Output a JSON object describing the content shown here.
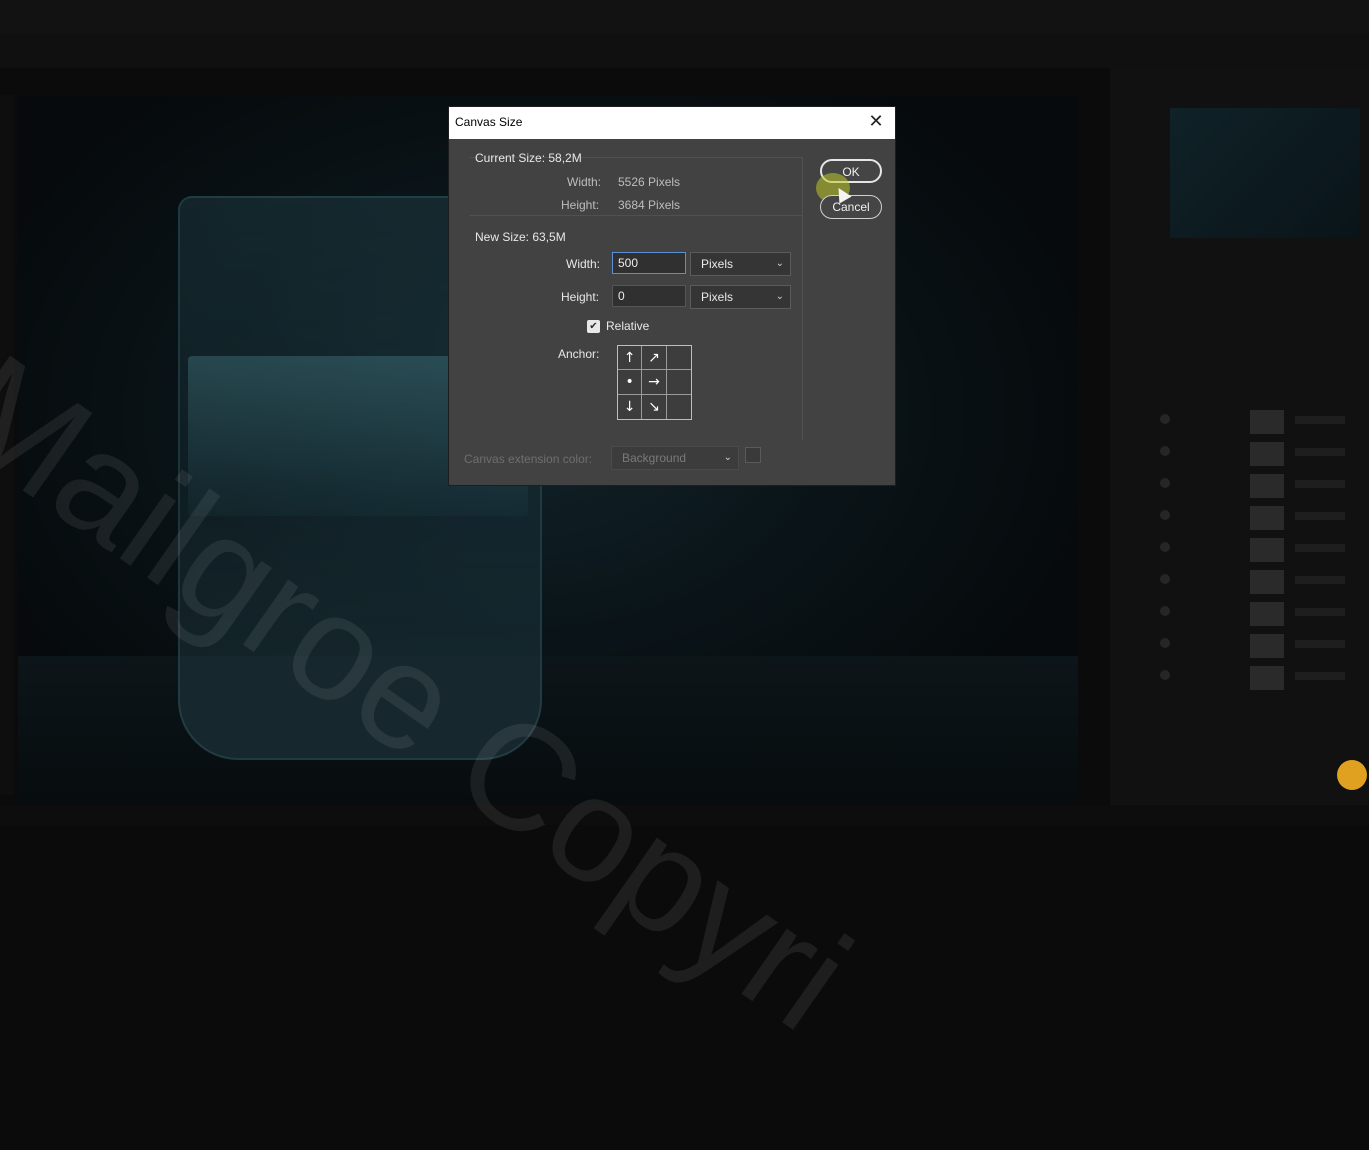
{
  "watermark": "Mailgroe Copyri",
  "dialog": {
    "title": "Canvas Size",
    "close_glyph": "✕",
    "current_size": {
      "label": "Current Size: 58,2M",
      "width_label": "Width:",
      "width_value": "5526 Pixels",
      "height_label": "Height:",
      "height_value": "3684 Pixels"
    },
    "new_size": {
      "label": "New Size: 63,5M",
      "width_label": "Width:",
      "width_value": "500",
      "width_unit": "Pixels",
      "height_label": "Height:",
      "height_value": "0",
      "height_unit": "Pixels"
    },
    "relative": {
      "label": "Relative",
      "checked": true,
      "check_glyph": "✔"
    },
    "anchor": {
      "label": "Anchor:",
      "cells": [
        "↑",
        "↗",
        "",
        "•",
        "→",
        "",
        "↓",
        "↘",
        ""
      ]
    },
    "extension_color": {
      "label": "Canvas extension color:",
      "value": "Background"
    },
    "buttons": {
      "ok": "OK",
      "cancel": "Cancel"
    },
    "chevron_glyph": "⌄"
  },
  "icons": {
    "close": "close-icon",
    "chevron": "chevron-down-icon",
    "checkbox": "checkmark-icon",
    "cursor": "mouse-pointer-icon"
  },
  "colors": {
    "dialog_bg": "#424242",
    "titlebar_bg": "#ffffff",
    "focus_border": "#5a8fd6",
    "cursor_highlight": "#bec828"
  }
}
